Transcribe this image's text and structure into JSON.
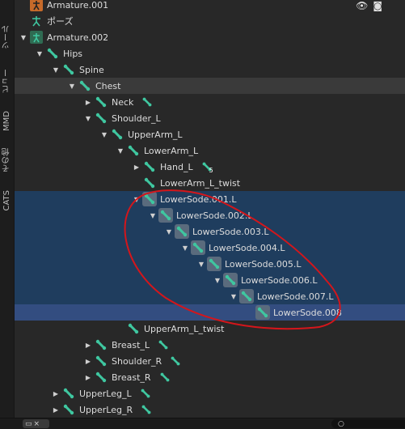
{
  "side_tabs": [
    {
      "label": "ツール"
    },
    {
      "label": "ビュー"
    },
    {
      "label": "MMD"
    },
    {
      "label": "その他"
    },
    {
      "label": "CATS"
    }
  ],
  "tree": {
    "rows": [
      {
        "label": "Armature.001",
        "arrow": "",
        "icon": "armature-object-icon",
        "state": ""
      },
      {
        "label": "ポーズ",
        "arrow": "",
        "icon": "pose-icon",
        "state": ""
      },
      {
        "label": "Armature.002",
        "arrow": "▼",
        "icon": "armature-data-icon",
        "state": ""
      },
      {
        "label": "Hips",
        "arrow": "▼",
        "icon": "bone-icon",
        "state": ""
      },
      {
        "label": "Spine",
        "arrow": "▼",
        "icon": "bone-icon",
        "state": ""
      },
      {
        "label": "Chest",
        "arrow": "▼",
        "icon": "bone-icon",
        "state": "hl"
      },
      {
        "label": "Neck",
        "arrow": "▶",
        "icon": "bone-icon",
        "state": ""
      },
      {
        "label": "Shoulder_L",
        "arrow": "▼",
        "icon": "bone-icon",
        "state": ""
      },
      {
        "label": "UpperArm_L",
        "arrow": "▼",
        "icon": "bone-icon",
        "state": ""
      },
      {
        "label": "LowerArm_L",
        "arrow": "▼",
        "icon": "bone-icon",
        "state": ""
      },
      {
        "label": "Hand_L",
        "arrow": "▶",
        "icon": "bone-icon",
        "state": "",
        "badge": "5"
      },
      {
        "label": "LowerArm_L_twist",
        "arrow": "",
        "icon": "bone-icon",
        "state": ""
      },
      {
        "label": "LowerSode.001.L",
        "arrow": "▼",
        "icon": "bone-icon",
        "state": "sel"
      },
      {
        "label": "LowerSode.002.L",
        "arrow": "▼",
        "icon": "bone-icon",
        "state": "sel"
      },
      {
        "label": "LowerSode.003.L",
        "arrow": "▼",
        "icon": "bone-icon",
        "state": "sel"
      },
      {
        "label": "LowerSode.004.L",
        "arrow": "▼",
        "icon": "bone-icon",
        "state": "sel"
      },
      {
        "label": "LowerSode.005.L",
        "arrow": "▼",
        "icon": "bone-icon",
        "state": "sel"
      },
      {
        "label": "LowerSode.006.L",
        "arrow": "▼",
        "icon": "bone-icon",
        "state": "sel"
      },
      {
        "label": "LowerSode.007.L",
        "arrow": "▼",
        "icon": "bone-icon",
        "state": "sel"
      },
      {
        "label": "LowerSode.008",
        "arrow": "",
        "icon": "bone-icon",
        "state": "active"
      },
      {
        "label": "UpperArm_L_twist",
        "arrow": "",
        "icon": "bone-icon",
        "state": ""
      },
      {
        "label": "Breast_L",
        "arrow": "▶",
        "icon": "bone-icon",
        "state": ""
      },
      {
        "label": "Shoulder_R",
        "arrow": "▶",
        "icon": "bone-icon",
        "state": ""
      },
      {
        "label": "Breast_R",
        "arrow": "▶",
        "icon": "bone-icon",
        "state": ""
      },
      {
        "label": "UpperLeg_L",
        "arrow": "▶",
        "icon": "bone-icon",
        "state": ""
      },
      {
        "label": "UpperLeg_R",
        "arrow": "▶",
        "icon": "bone-icon",
        "state": ""
      }
    ]
  },
  "colors": {
    "bone": "#3fc7a0",
    "selected_row": "#1f3d5e",
    "active_row": "#334d80",
    "annotation": "#d4161b"
  },
  "bottom": {
    "left_label": "×",
    "search_icon": "search-icon"
  }
}
